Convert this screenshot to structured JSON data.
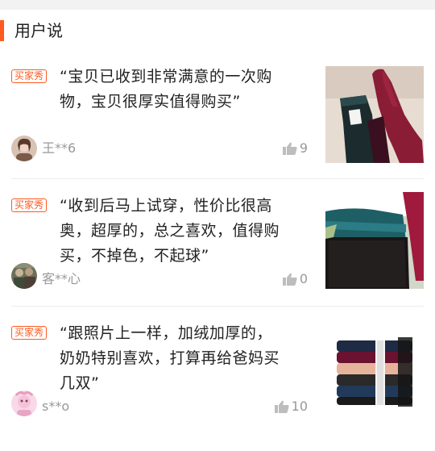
{
  "section": {
    "title": "用户说"
  },
  "reviews": [
    {
      "badge": "买家秀",
      "quote_line1": "“宝贝已收到非常满意的一次购",
      "quote_line2": "物，宝贝很厚实值得购买”",
      "quote_line3": "",
      "username": "王**6",
      "likes": "9",
      "avatar": "avatar-woman-icon",
      "photo": "socks-photo-black-and-red"
    },
    {
      "badge": "买家秀",
      "quote_line1": "“收到后马上试穿，性价比很高",
      "quote_line2": "奥，超厚的，总之喜欢，值得购",
      "quote_line3": "买，不掉色，不起球”",
      "username": "客**心",
      "likes": "0",
      "avatar": "avatar-group-icon",
      "photo": "socks-photo-fleece-lined"
    },
    {
      "badge": "买家秀",
      "quote_line1": "“跟照片上一样，加绒加厚的，",
      "quote_line2": "奶奶特别喜欢，打算再给爸妈买",
      "quote_line3": "几双”",
      "username": "s**o",
      "likes": "10",
      "avatar": "avatar-pink-icon",
      "photo": "socks-photo-stacked"
    }
  ],
  "colors": {
    "accent": "#ff5a1f",
    "muted": "#999999",
    "divider": "#ececec"
  }
}
